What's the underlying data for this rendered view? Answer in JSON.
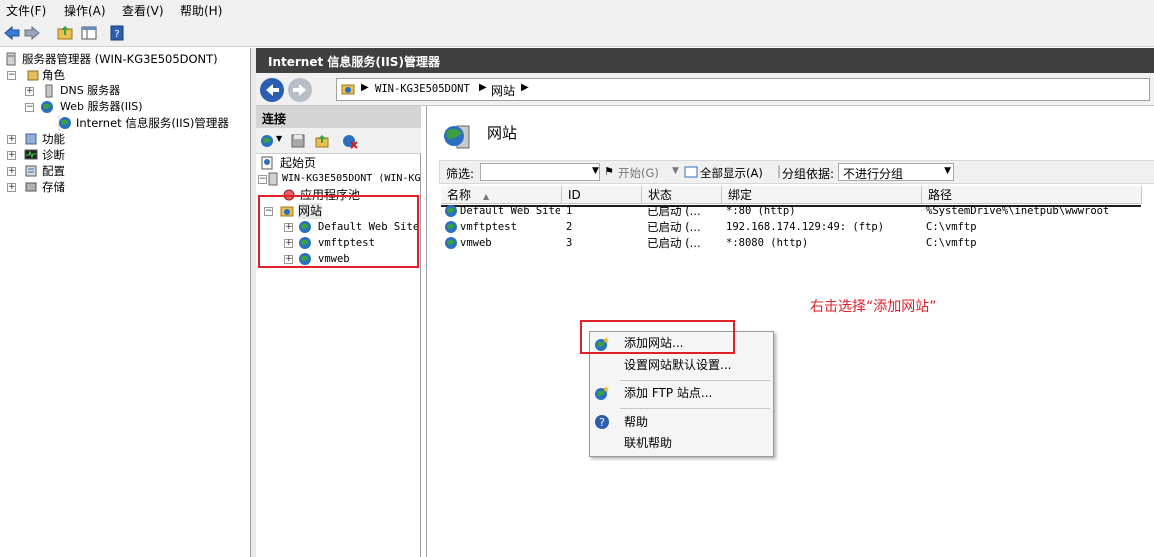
{
  "menubar": {
    "file": "文件(F)",
    "action": "操作(A)",
    "view": "查看(V)",
    "help": "帮助(H)"
  },
  "left_tree": {
    "root": "服务器管理器 (WIN-KG3E505DONT)",
    "roles": "角色",
    "dns": "DNS 服务器",
    "web": "Web 服务器(IIS)",
    "iis_mgr": "Internet 信息服务(IIS)管理器",
    "features": "功能",
    "diagnostics": "诊断",
    "config": "配置",
    "storage": "存储"
  },
  "iis_header": "Internet 信息服务(IIS)管理器",
  "breadcrumb": {
    "server": "WIN-KG3E505DONT",
    "sites": "网站"
  },
  "connections": {
    "title": "连接",
    "start_page": "起始页",
    "server": "WIN-KG3E505DONT (WIN-KG",
    "app_pools": "应用程序池",
    "sites": "网站",
    "site_items": [
      "Default Web Site",
      "vmftptest",
      "vmweb"
    ]
  },
  "main": {
    "title": "网站",
    "filter_label": "筛选:",
    "start_label": "开始(G)",
    "show_all": "全部显示(A)",
    "group_label": "分组依据:",
    "group_value": "不进行分组",
    "columns": [
      "名称",
      "ID",
      "状态",
      "绑定",
      "路径"
    ],
    "rows": [
      [
        "Default Web Site",
        "1",
        "已启动 (...",
        "*:80 (http)",
        "%SystemDrive%\\inetpub\\wwwroot"
      ],
      [
        "vmftptest",
        "2",
        "已启动 (...",
        "192.168.174.129:49: (ftp)",
        "C:\\vmftp"
      ],
      [
        "vmweb",
        "3",
        "已启动 (...",
        "*:8080 (http)",
        "C:\\vmftp"
      ]
    ]
  },
  "context_menu": {
    "add_site": "添加网站...",
    "default_settings": "设置网站默认设置...",
    "add_ftp": "添加 FTP 站点...",
    "help": "帮助",
    "online_help": "联机帮助"
  },
  "annotation": "右击选择“添加网站”",
  "colors": {
    "annotation_red": "#e0202a",
    "header_dark": "#404040",
    "globe_blue": "#2a6fc0",
    "globe_green": "#3aa040"
  }
}
